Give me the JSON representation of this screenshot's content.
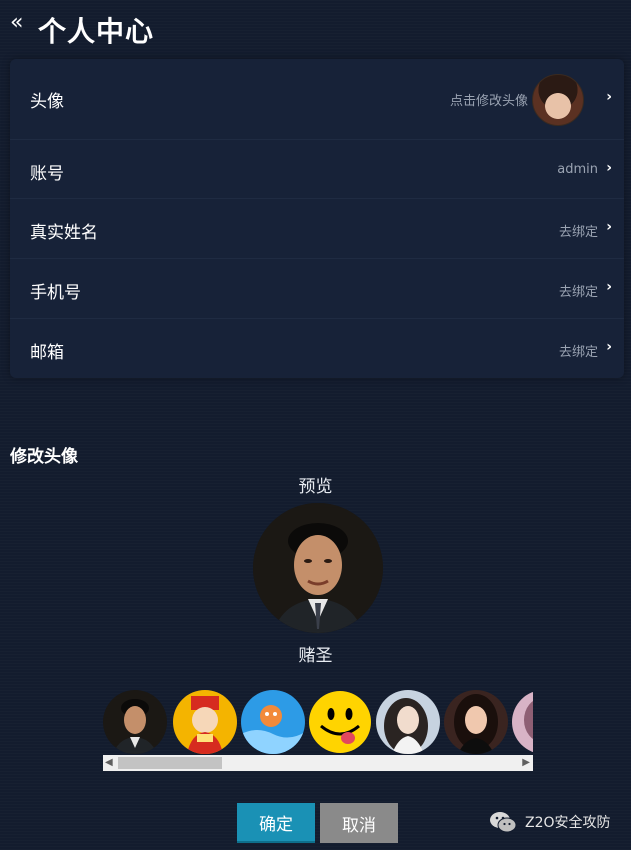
{
  "header": {
    "back_icon": "double-chevron-left-icon",
    "title": "个人中心"
  },
  "profile_rows": [
    {
      "label": "头像",
      "value": "点击修改头像"
    },
    {
      "label": "账号",
      "value": "admin"
    },
    {
      "label": "真实姓名",
      "value": "去绑定"
    },
    {
      "label": "手机号",
      "value": "去绑定"
    },
    {
      "label": "邮箱",
      "value": "去绑定"
    }
  ],
  "avatar_editor": {
    "section_title": "修改头像",
    "preview_label": "预览",
    "selected_name": "赌圣",
    "options_count_visible": 7
  },
  "actions": {
    "confirm_label": "确定",
    "cancel_label": "取消"
  },
  "watermark": {
    "icon": "wechat-icon",
    "text": "Z2O安全攻防"
  },
  "colors": {
    "background": "#131c2e",
    "card": "#172238",
    "confirm": "#1a91b5",
    "cancel": "#8a8a8a"
  }
}
